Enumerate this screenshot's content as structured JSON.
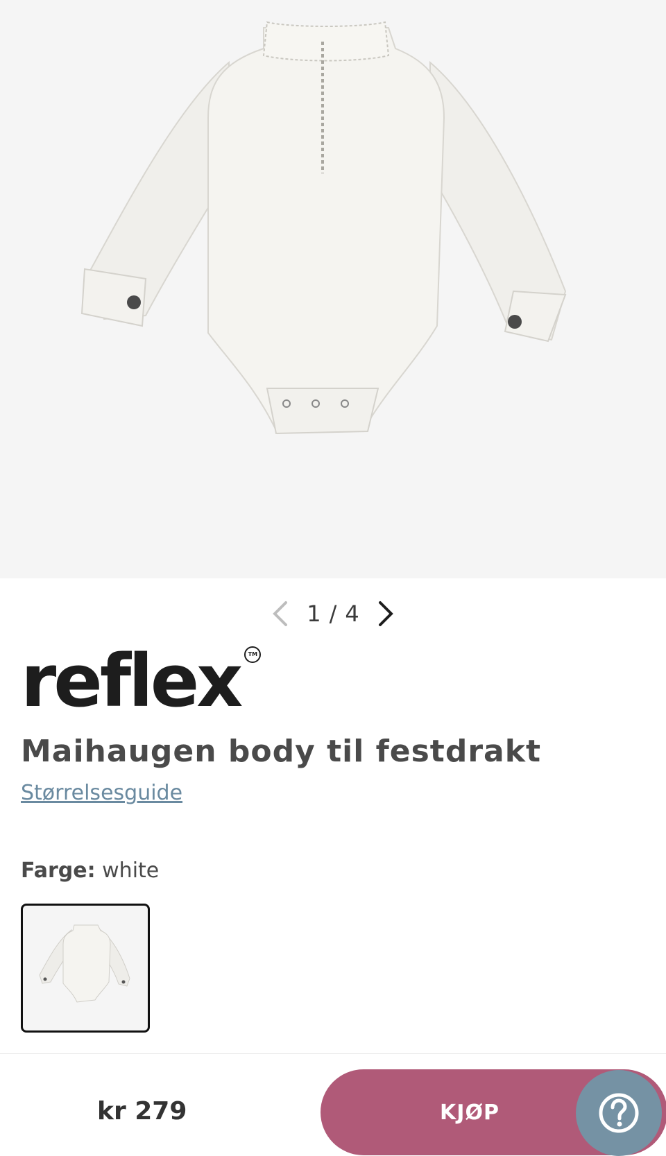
{
  "gallery": {
    "current": "1",
    "separator": "/",
    "total": "4"
  },
  "brand": {
    "name": "reflex",
    "tm": "TM"
  },
  "product": {
    "title": "Maihaugen body til festdrakt",
    "size_guide": "Størrelsesguide",
    "color_label": "Farge:",
    "color_value": "white"
  },
  "checkout": {
    "price": "kr 279",
    "buy_label": "KJØP"
  },
  "colors": {
    "buy_button": "#b05a78",
    "help_button": "#7592a4",
    "link": "#6a8aa0"
  },
  "icons": {
    "prev": "chevron-left-icon",
    "next": "chevron-right-icon",
    "help": "question-icon"
  }
}
